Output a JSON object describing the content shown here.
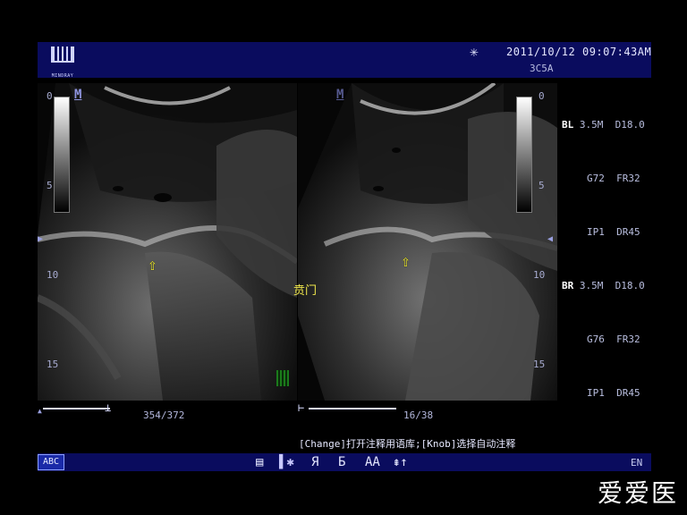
{
  "header": {
    "brand": "MINDRAY",
    "datetime": "2011/10/12  09:07:43AM",
    "probe": "3C5A"
  },
  "params_left": {
    "tag": "BL",
    "line1": " 3.5M  D18.0",
    "line2": "G72  FR32",
    "line3": "IP1  DR45"
  },
  "params_right": {
    "tag": "BR",
    "line1": " 3.5M  D18.0",
    "line2": "G76  FR32",
    "line3": "IP1  DR45"
  },
  "depth_scale": {
    "d0": "0",
    "d5": "5",
    "d10": "10",
    "d15": "15"
  },
  "annotation": "贲门",
  "frames": {
    "left": "354/372",
    "right": "16/38"
  },
  "hint": "[Change]打开注释用语库;[Knob]选择自动注释",
  "toolbar": {
    "abc": "ABC",
    "notes": "▤",
    "mark": "▌✱",
    "ya": "Я",
    "b": "Ƃ",
    "font": "AA",
    "arrows": "⇞↑",
    "lang": "EN"
  },
  "watermark": "爱爱医"
}
